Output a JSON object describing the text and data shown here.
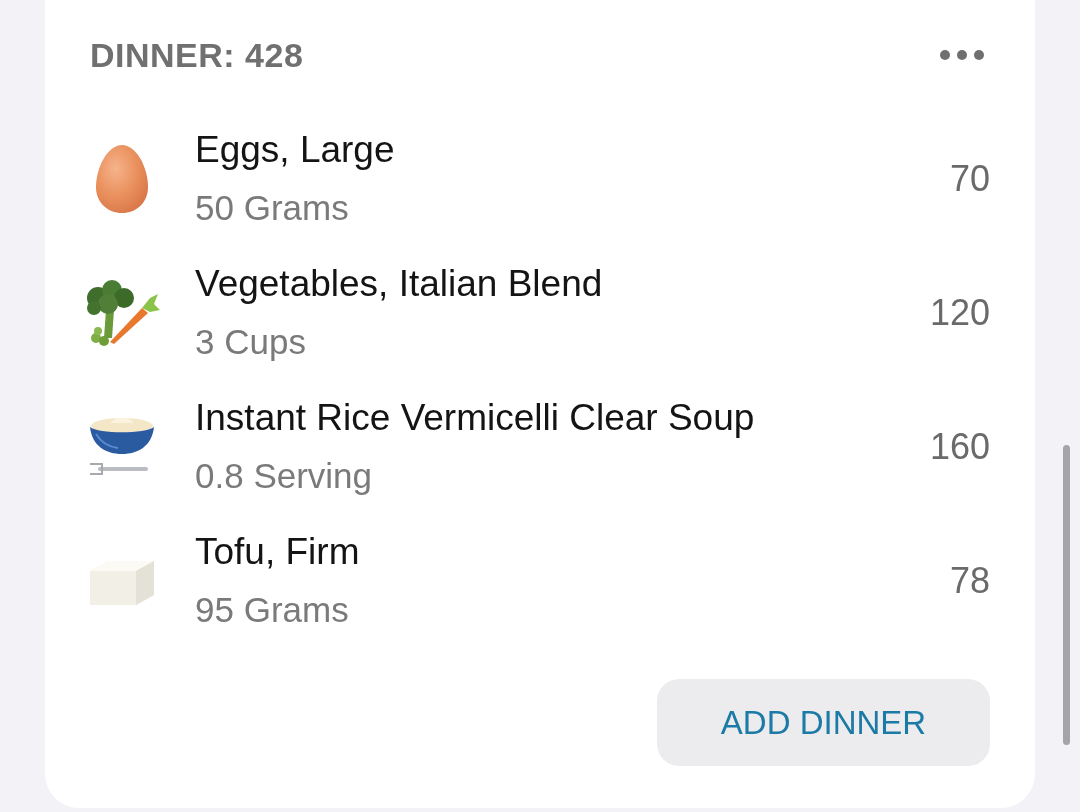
{
  "meal": {
    "title": "DINNER: 428",
    "items": [
      {
        "kind": "egg",
        "name": "Eggs, Large",
        "amount": "50 Grams",
        "calories": "70"
      },
      {
        "kind": "vegetables",
        "name": "Vegetables, Italian Blend",
        "amount": "3 Cups",
        "calories": "120"
      },
      {
        "kind": "bowl",
        "name": "Instant Rice Vermicelli Clear Soup",
        "amount": "0.8 Serving",
        "calories": "160"
      },
      {
        "kind": "tofu",
        "name": "Tofu, Firm",
        "amount": "95 Grams",
        "calories": "78"
      }
    ],
    "add_button": "ADD DINNER"
  }
}
